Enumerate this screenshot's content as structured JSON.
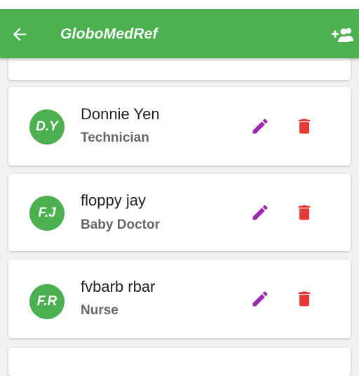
{
  "appbar": {
    "title": "GloboMedRef",
    "back_icon": "arrow-back-icon",
    "add_icon": "add-person-icon",
    "color": "#4caf50"
  },
  "staff": [
    {
      "initials": "D.Y",
      "name": "Donnie Yen",
      "role": "Technician"
    },
    {
      "initials": "F.J",
      "name": "floppy jay",
      "role": "Baby Doctor"
    },
    {
      "initials": "F.R",
      "name": "fvbarb rbar",
      "role": "Nurse"
    }
  ],
  "colors": {
    "avatar": "#4caf50",
    "edit_icon": "#9c27b0",
    "delete_icon": "#e53935"
  },
  "icons": {
    "edit": "pencil-edit-icon",
    "delete": "trash-delete-icon"
  }
}
